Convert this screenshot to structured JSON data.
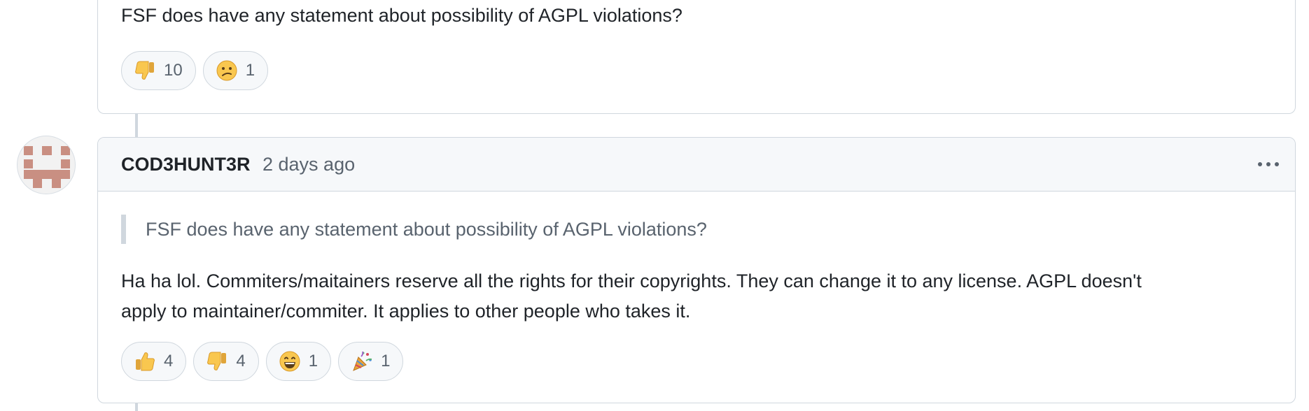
{
  "previous_comment": {
    "text": "FSF does have any statement about possibility of AGPL violations?",
    "reactions": [
      {
        "icon": "thumbs-down-icon",
        "count": "10"
      },
      {
        "icon": "confused-face-icon",
        "count": "1"
      }
    ]
  },
  "comment": {
    "author": "COD3HUNT3R",
    "timestamp": "2 days ago",
    "quote": "FSF does have any statement about possibility of AGPL violations?",
    "body_line_1": "Ha ha lol. Commiters/maitainers reserve all the rights for their copyrights. They can change it to any license. AGPL doesn't",
    "body_line_2": "apply to maintainer/commiter. It applies to other people who takes it.",
    "reactions": [
      {
        "icon": "thumbs-up-icon",
        "count": "4"
      },
      {
        "icon": "thumbs-down-icon",
        "count": "4"
      },
      {
        "icon": "grinning-face-icon",
        "count": "1"
      },
      {
        "icon": "party-popper-icon",
        "count": "1"
      }
    ]
  },
  "colors": {
    "border": "#d0d7de",
    "header_bg": "#f6f8fa",
    "muted_text": "#59636e",
    "avatar_color": "#c98f82"
  }
}
